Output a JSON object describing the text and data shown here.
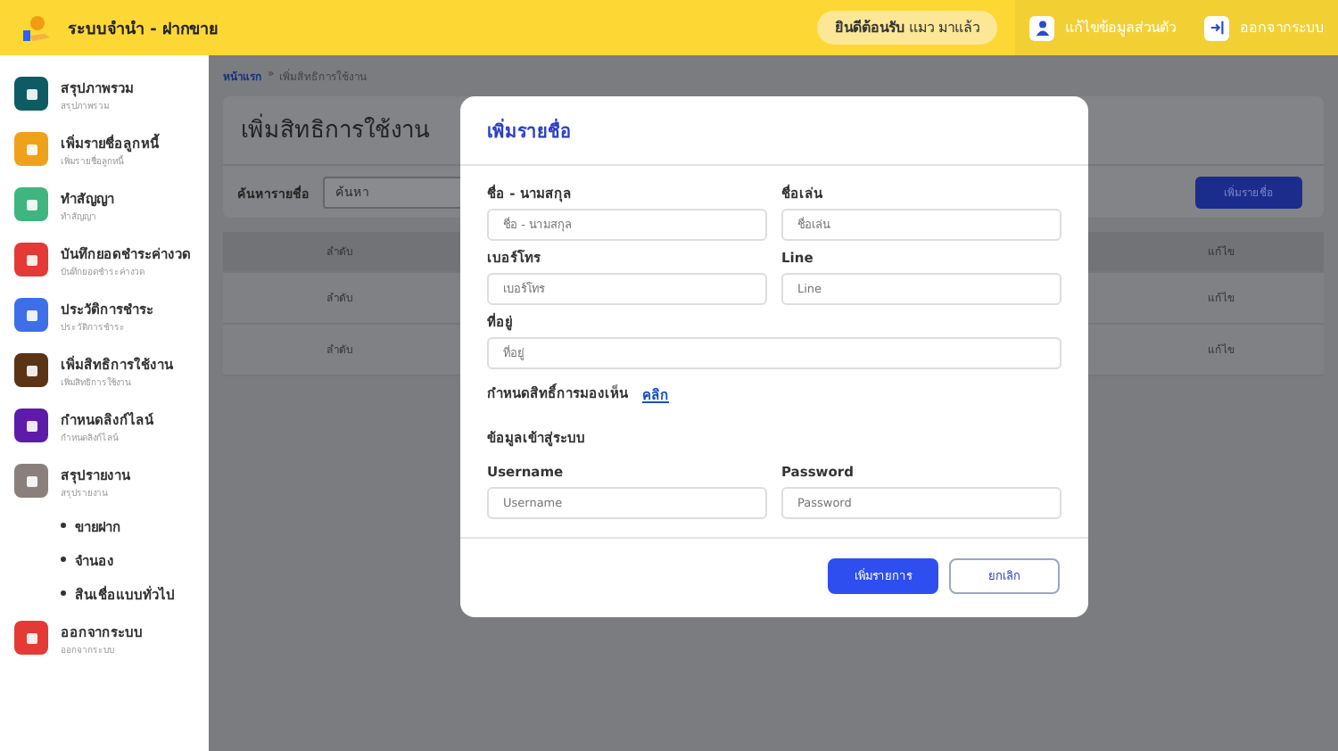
{
  "header": {
    "title": "ระบบจำนำ - ฝากขาย",
    "welcome": "**ยินดีต้อนรับ** แมว มาแล้ว",
    "actions": [
      {
        "label": "แก้ไขข้อมูลส่วนตัว"
      },
      {
        "label": "ออกจากระบบ"
      }
    ]
  },
  "sidebar": {
    "items": [
      {
        "title": "สรุปภาพรวม",
        "subtitle": "สรุปภาพรวม",
        "color": "#0d5c63"
      },
      {
        "title": "เพิ่มรายชื่อลูกหนี้",
        "subtitle": "เพิ่มรายชื่อลูกหนี้",
        "color": "#f0a11a"
      },
      {
        "title": "ทำสัญญา",
        "subtitle": "ทำสัญญา",
        "color": "#3fb57f"
      },
      {
        "title": "บันทึกยอดชำระค่างวด",
        "subtitle": "บันทึกยอดชำระค่างวด",
        "color": "#e53935"
      },
      {
        "title": "ประวัติการชำระ",
        "subtitle": "ประวัติการชำระ",
        "color": "#3d6fe8"
      },
      {
        "title": "เพิ่มสิทธิการใช้งาน",
        "subtitle": "เพิ่มสิทธิการใช้งาน",
        "color": "#5b3416"
      },
      {
        "title": "กำหนดลิงก์ไลน์",
        "subtitle": "กำหนดลิงก์ไลน์",
        "color": "#5e1aa8"
      },
      {
        "title": "สรุปรายงาน",
        "subtitle": "สรุปรายงาน",
        "color": "#8a7f7a",
        "children": [
          {
            "title": "ขายฝาก"
          },
          {
            "title": "จำนอง"
          },
          {
            "title": "สินเชื่อแบบทั่วไป"
          }
        ]
      },
      {
        "title": "ออกจากระบบ",
        "subtitle": "ออกจากระบบ",
        "color": "#e53935"
      }
    ]
  },
  "breadcrumb": {
    "link": "หน้าแรก",
    "separator": "»",
    "current": "เพิ่มสิทธิการใช้งาน"
  },
  "page": {
    "title": "เพิ่มสิทธิการใช้งาน",
    "search_label": "ค้นหารายชื่อ",
    "search_placeholder": "ค้นหา",
    "add_button": "เพิ่มรายชื่อ"
  },
  "table": {
    "columns": [
      "ลำดับ",
      "แก้ไข"
    ],
    "rows": [
      [
        "ลำดับ",
        "แก้ไข"
      ],
      [
        "ลำดับ",
        "แก้ไข"
      ]
    ]
  },
  "modal": {
    "title": "เพิ่มรายชื่อ",
    "rows": [
      [
        {
          "label": "ชื่อ - นามสกุล",
          "placeholder": "ชื่อ - นามสกุล"
        },
        {
          "label": "ชื่อเล่น",
          "placeholder": "ชื่อเล่น"
        }
      ],
      [
        {
          "label": "เบอร์โทร",
          "placeholder": "เบอร์โทร"
        },
        {
          "label": "Line",
          "placeholder": "Line"
        }
      ],
      [
        {
          "label": "ที่อยู่",
          "placeholder": "ที่อยู่"
        }
      ]
    ],
    "permission_label": "กำหนดสิทธิ์การมองเห็น",
    "permission_link": "คลิก",
    "login_section": "ข้อมูลเข้าสู่ระบบ",
    "login_rows": [
      [
        {
          "label": "Username",
          "placeholder": "Username"
        },
        {
          "label": "Password",
          "placeholder": "Password"
        }
      ]
    ],
    "buttons": [
      {
        "label": "เพิ่มรายการ",
        "kind": "primary"
      },
      {
        "label": "ยกเลิก",
        "kind": "secondary"
      }
    ]
  }
}
